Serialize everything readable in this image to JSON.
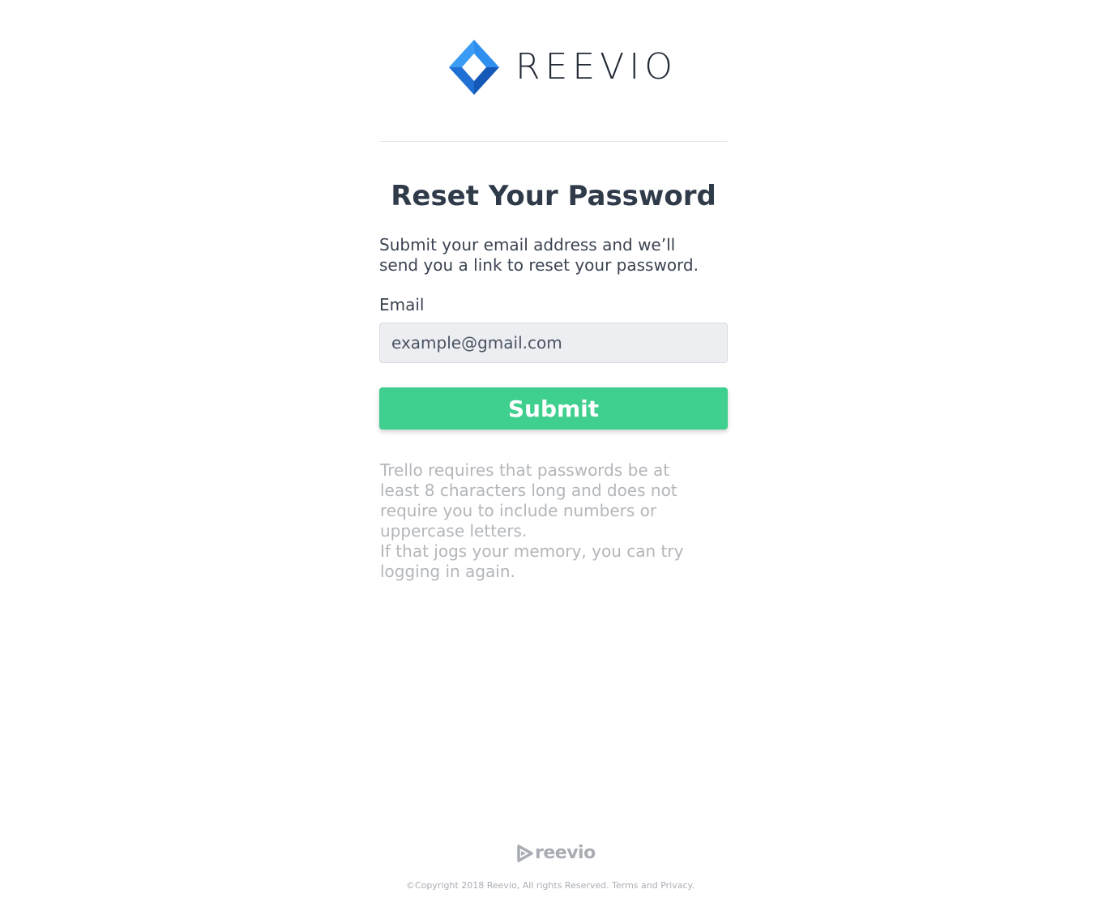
{
  "brand": {
    "name": "REEVIO",
    "footer_name": "reevio",
    "colors": {
      "mark_light": "#2f8fef",
      "mark_dark": "#1459b8",
      "accent_green": "#3fcf8e",
      "text_dark": "#303b4a",
      "text_muted": "#b3b6ba"
    }
  },
  "form": {
    "title": "Reset Your Password",
    "subtitle": "Submit your email address and we’ll send you a link to reset your password.",
    "email_label": "Email",
    "email_placeholder": "example@gmail.com",
    "submit_label": "Submit"
  },
  "help": {
    "requirements": "Trello requires that passwords be at least 8 characters long and does not require you to include numbers or uppercase letters.",
    "memory": "If that jogs your memory, you can try logging in again."
  },
  "footer": {
    "copyright": "©Copyright 2018 Reevio, All rights Reserved. Terms and Privacy."
  }
}
